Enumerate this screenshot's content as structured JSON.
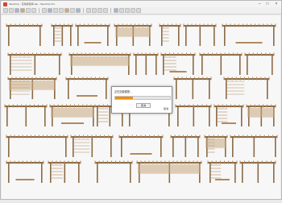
{
  "window": {
    "title": "SketchUp - 花架模型库.skp - SketchUp Pro"
  },
  "toolbar": {
    "buttons": [
      "select-tool",
      "eraser-tool",
      "paint-tool",
      "line-tool",
      "rectangle-tool",
      "circle-tool",
      "pushpull-tool",
      "move-tool",
      "rotate-tool",
      "scale-tool",
      "offset-tool",
      "tape-tool",
      "text-tool",
      "orbit-tool",
      "pan-tool",
      "zoom-tool",
      "zoom-extents-tool",
      "prev-view",
      "next-view",
      "iso-view",
      "top-view",
      "front-view"
    ]
  },
  "dialog": {
    "title": "正在加载模型...",
    "progress": 0.32,
    "button_label": "取消",
    "link_label": "取消"
  },
  "colors": {
    "wood": "#b08a5e",
    "wood_dark": "#8b6a45",
    "progress": "#f08c10"
  }
}
